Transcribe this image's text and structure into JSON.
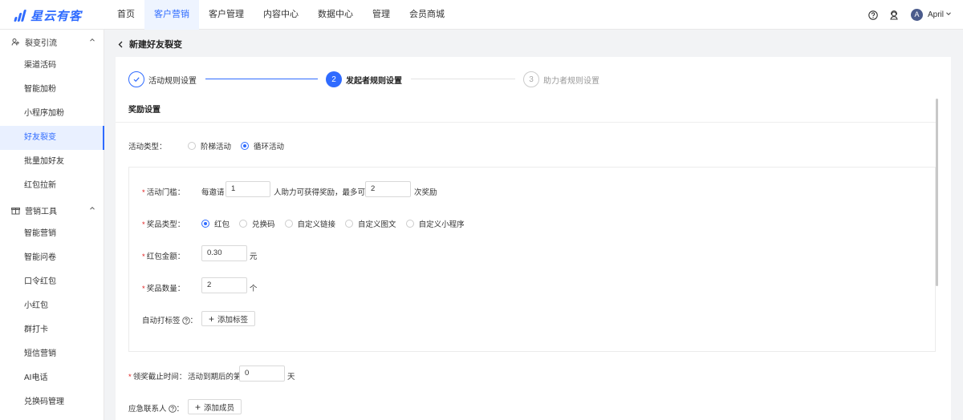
{
  "brand": {
    "name": "星云有客"
  },
  "nav": [
    {
      "label": "首页"
    },
    {
      "label": "客户营销"
    },
    {
      "label": "客户管理"
    },
    {
      "label": "内容中心"
    },
    {
      "label": "数据中心"
    },
    {
      "label": "管理"
    },
    {
      "label": "会员商城"
    }
  ],
  "nav_active": "客户营销",
  "user": {
    "avatar_letter": "A",
    "name": "April"
  },
  "sidebar": {
    "groups": [
      {
        "title": "裂变引流",
        "items": [
          "渠道活码",
          "智能加粉",
          "小程序加粉",
          "好友裂变",
          "批量加好友",
          "红包拉新"
        ]
      },
      {
        "title": "营销工具",
        "items": [
          "智能营销",
          "智能问卷",
          "口令红包",
          "小红包",
          "群打卡",
          "短信营销",
          "AI电话",
          "兑换码管理"
        ]
      }
    ],
    "active_item": "好友裂变"
  },
  "page": {
    "title": "新建好友裂变"
  },
  "steps": [
    {
      "index": "1",
      "label": "活动规则设置",
      "status": "done"
    },
    {
      "index": "2",
      "label": "发起者规则设置",
      "status": "active"
    },
    {
      "index": "3",
      "label": "助力者规则设置",
      "status": "pending"
    }
  ],
  "form": {
    "section_title": "奖励设置",
    "activity_type": {
      "label": "活动类型：",
      "options": [
        "阶梯活动",
        "循环活动"
      ],
      "selected": "循环活动"
    },
    "threshold": {
      "label": "活动门槛：",
      "prefix": "每邀请",
      "value1": "1",
      "middle": "人助力可获得奖励，最多可得",
      "value2": "2",
      "suffix": "次奖励"
    },
    "prize_type": {
      "label": "奖品类型：",
      "options": [
        "红包",
        "兑换码",
        "自定义链接",
        "自定义图文",
        "自定义小程序"
      ],
      "selected": "红包"
    },
    "red_packet_amount": {
      "label": "红包金额：",
      "value": "0.30",
      "unit": "元"
    },
    "prize_count": {
      "label": "奖品数量：",
      "value": "2",
      "unit": "个"
    },
    "auto_tag": {
      "label": "自动打标签",
      "colon": "：",
      "button": "添加标签"
    },
    "claim_deadline": {
      "label": "领奖截止时间：",
      "prefix": "活动到期后的第",
      "value": "0",
      "unit": "天"
    },
    "emergency_contact": {
      "label": "应急联系人",
      "colon": "：",
      "button": "添加成员"
    }
  },
  "colors": {
    "accent": "#2f6bff",
    "required": "#e02020"
  }
}
